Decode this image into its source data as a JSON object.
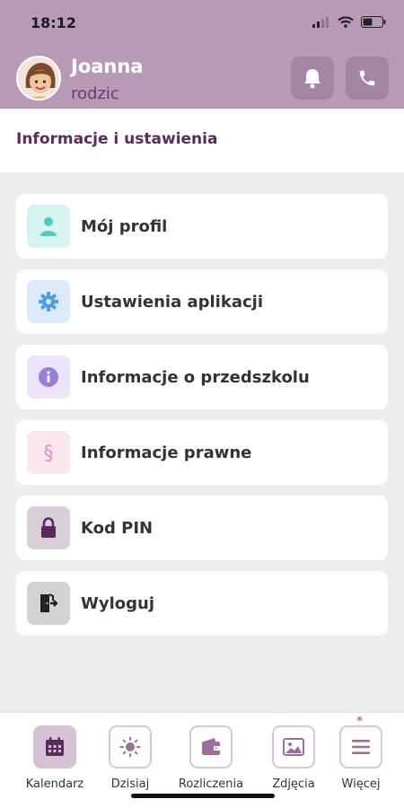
{
  "status_bar": {
    "time": "18:12"
  },
  "user": {
    "name": "Joanna",
    "role": "rodzic"
  },
  "section_title": "Informacje i ustawienia",
  "menu": [
    {
      "label": "Mój profil",
      "icon": "person-icon",
      "color": "#55c9c0",
      "bg": "#d6f3f1"
    },
    {
      "label": "Ustawienia aplikacji",
      "icon": "gear-icon",
      "color": "#4a9fe6",
      "bg": "#dbebfb"
    },
    {
      "label": "Informacje o przedszkolu",
      "icon": "info-icon",
      "color": "#9b7de0",
      "bg": "#ece4fa"
    },
    {
      "label": "Informacje prawne",
      "icon": "section-sign-icon",
      "color": "#e88db6",
      "bg": "#fbe7f0"
    },
    {
      "label": "Kod PIN",
      "icon": "lock-icon",
      "color": "#5a2a5c",
      "bg": "#d9cfd9"
    },
    {
      "label": "Wyloguj",
      "icon": "logout-icon",
      "color": "#2b2b2b",
      "bg": "#d3d3d3"
    }
  ],
  "tabs": [
    {
      "label": "Kalendarz",
      "icon": "calendar-icon",
      "active": true
    },
    {
      "label": "Dzisiaj",
      "icon": "sun-icon",
      "active": false
    },
    {
      "label": "Rozliczenia",
      "icon": "wallet-icon",
      "active": false
    },
    {
      "label": "Zdjęcia",
      "icon": "image-icon",
      "active": false
    },
    {
      "label": "Więcej",
      "icon": "menu-icon",
      "active": false
    }
  ],
  "colors": {
    "header": "#b89ab7",
    "accent": "#5a2a5c",
    "notification_dot": "#e07aa6"
  }
}
